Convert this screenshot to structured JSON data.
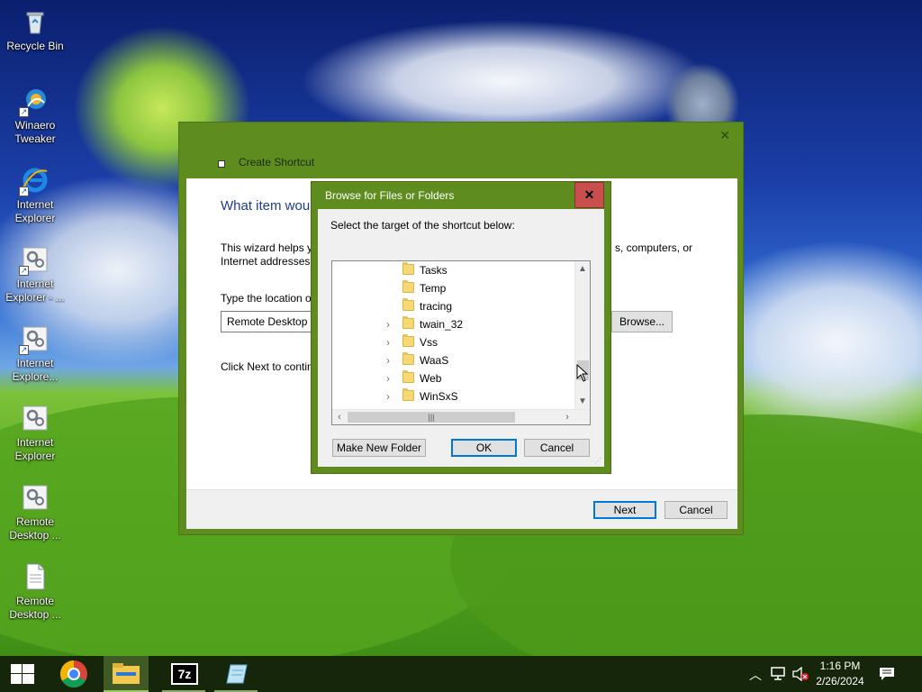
{
  "desktop": {
    "icons": [
      {
        "label": "Recycle Bin",
        "icon": "recycle-bin-icon"
      },
      {
        "label": "Winaero Tweaker",
        "icon": "winaero-tweaker-icon"
      },
      {
        "label": "Internet Explorer",
        "icon": "internet-explorer-icon"
      },
      {
        "label": "Internet Explorer - ...",
        "icon": "settings-shortcut-icon"
      },
      {
        "label": "Internet Explore...",
        "icon": "settings-shortcut-icon"
      },
      {
        "label": "Internet Explorer",
        "icon": "settings-icon"
      },
      {
        "label": "Remote Desktop ...",
        "icon": "settings-icon"
      },
      {
        "label": "Remote Desktop ...",
        "icon": "document-icon"
      }
    ]
  },
  "wizard": {
    "title": "Create Shortcut",
    "close_glyph": "✕",
    "heading": "What item wou",
    "desc_line1_start": "This wizard helps yo",
    "desc_line1_end": "s, computers, or",
    "desc_line2": "Internet addresses.",
    "location_label": "Type the location o",
    "location_value": "Remote Desktop C",
    "browse_label": "Browse...",
    "next_hint": "Click Next to contin",
    "next_label": "Next",
    "cancel_label": "Cancel"
  },
  "browse_dialog": {
    "title": "Browse for Files or Folders",
    "close_glyph": "✕",
    "instruction": "Select the target of the shortcut below:",
    "folders": [
      {
        "name": "Tasks",
        "expandable": false
      },
      {
        "name": "Temp",
        "expandable": false
      },
      {
        "name": "tracing",
        "expandable": false
      },
      {
        "name": "twain_32",
        "expandable": true
      },
      {
        "name": "Vss",
        "expandable": true
      },
      {
        "name": "WaaS",
        "expandable": true
      },
      {
        "name": "Web",
        "expandable": true
      },
      {
        "name": "WinSxS",
        "expandable": true
      }
    ],
    "make_new_folder_label": "Make New Folder",
    "ok_label": "OK",
    "cancel_label": "Cancel"
  },
  "taskbar": {
    "apps": [
      {
        "name": "start",
        "icon": "windows-start-icon"
      },
      {
        "name": "chrome",
        "icon": "chrome-icon"
      },
      {
        "name": "file-explorer",
        "icon": "file-explorer-icon"
      },
      {
        "name": "7zip",
        "icon": "7zip-icon",
        "label": "7z"
      },
      {
        "name": "notepad",
        "icon": "notepad-icon"
      }
    ],
    "time": "1:16 PM",
    "date": "2/26/2024"
  },
  "colors": {
    "accent": "#5f8c1f",
    "close_red": "#c94f4f",
    "heading_blue": "#1e3d8f",
    "taskbar": "#15260a"
  }
}
